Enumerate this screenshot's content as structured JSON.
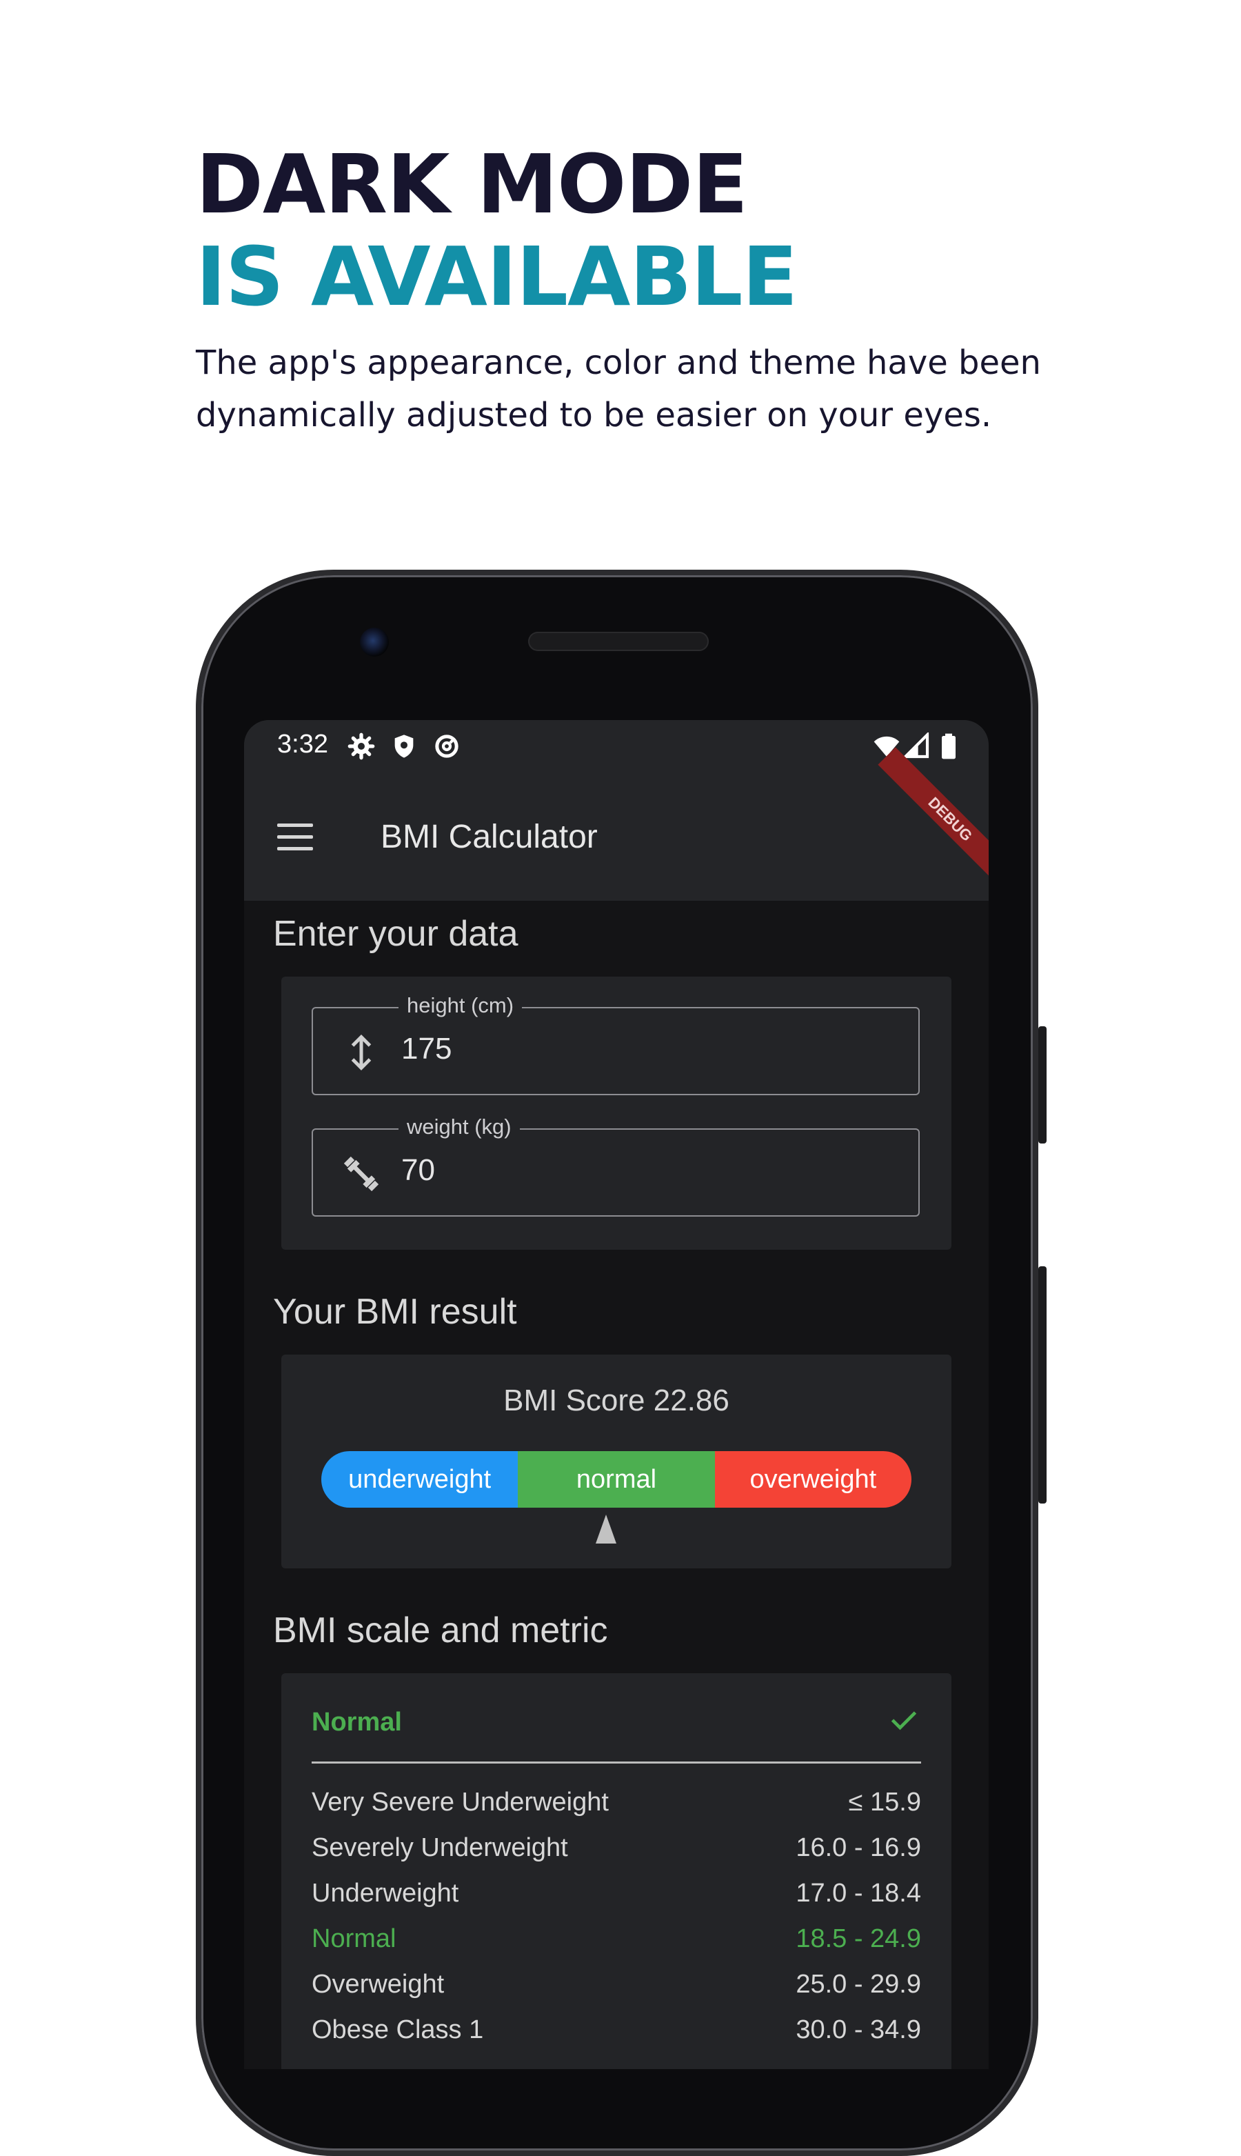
{
  "promo": {
    "headline_line1": "DARK MODE",
    "headline_line2": "IS AVAILABLE",
    "subtitle": "The app's appearance, color and theme have been dynamically adjusted to be easier on your eyes."
  },
  "status_bar": {
    "time": "3:32",
    "left_icons": [
      "gear-icon",
      "shield-icon",
      "at-sign-icon"
    ],
    "right_icons": [
      "wifi-icon",
      "signal-icon",
      "battery-icon"
    ]
  },
  "app_bar": {
    "title": "BMI Calculator",
    "debug_banner": "DEBUG"
  },
  "input_section": {
    "title": "Enter your data",
    "height": {
      "label": "height (cm)",
      "value": "175",
      "icon": "height-arrows-icon"
    },
    "weight": {
      "label": "weight (kg)",
      "value": "70",
      "icon": "dumbbell-icon"
    }
  },
  "result_section": {
    "title": "Your BMI result",
    "score_text": "BMI Score 22.86",
    "scale": {
      "underweight": "underweight",
      "normal": "normal",
      "overweight": "overweight"
    }
  },
  "metric_section": {
    "title": "BMI scale and metric",
    "active_category": "Normal",
    "rows": [
      {
        "name": "Very Severe Underweight",
        "range": "≤ 15.9"
      },
      {
        "name": "Severely Underweight",
        "range": "16.0 - 16.9"
      },
      {
        "name": "Underweight",
        "range": "17.0 - 18.4"
      },
      {
        "name": "Normal",
        "range": "18.5 - 24.9"
      },
      {
        "name": "Overweight",
        "range": "25.0 - 29.9"
      },
      {
        "name": "Obese Class 1",
        "range": "30.0 - 34.9"
      }
    ]
  },
  "colors": {
    "headline_dark": "#17152e",
    "headline_accent": "#1390a8",
    "underweight": "#2196f3",
    "normal": "#4caf50",
    "overweight": "#f44336"
  }
}
